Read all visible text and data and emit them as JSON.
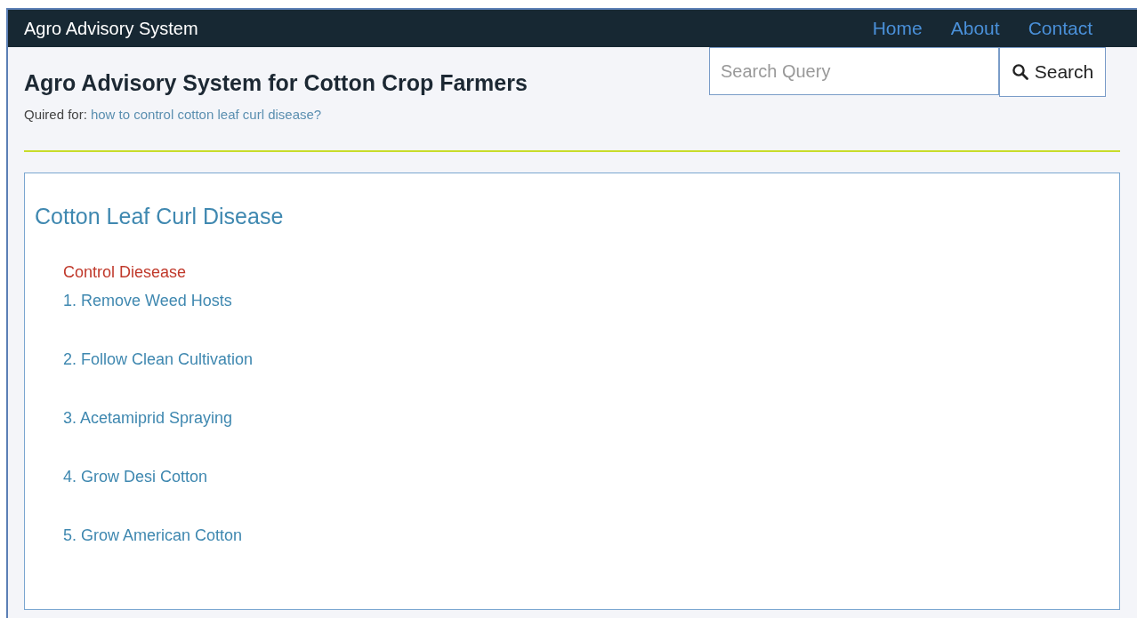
{
  "navbar": {
    "brand": "Agro Advisory System",
    "links": [
      "Home",
      "About",
      "Contact"
    ]
  },
  "header": {
    "title": "Agro Advisory System for Cotton Crop Farmers",
    "query_label": "Quired for:",
    "query_text": "how to control cotton leaf curl disease?"
  },
  "search": {
    "placeholder": "Search Query",
    "button": "Search"
  },
  "result": {
    "title": "Cotton Leaf Curl Disease",
    "section_heading": "Control Diesease",
    "steps": [
      "1. Remove Weed Hosts",
      "2. Follow Clean Cultivation",
      "3. Acetamiprid Spraying",
      "4. Grow Desi Cotton",
      "5. Grow American Cotton"
    ]
  }
}
